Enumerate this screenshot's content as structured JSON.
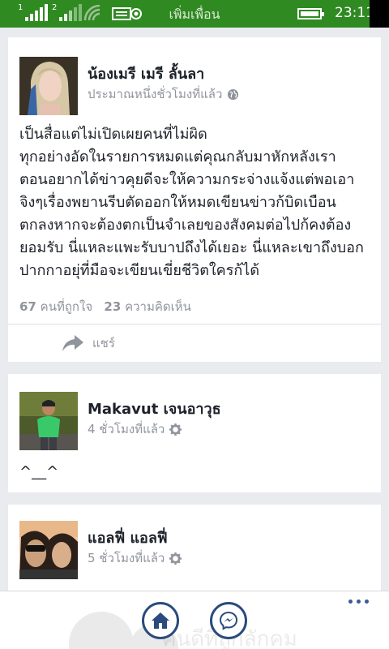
{
  "status_bar": {
    "title": "เพิ่มเพื่อน",
    "time": "23:11",
    "sim1": "1",
    "sim2": "2",
    "icons": [
      "signal-icon",
      "wifi-icon",
      "message-icon",
      "battery-icon"
    ],
    "background": "#2f8a22"
  },
  "posts": [
    {
      "author": "น้องเมรี เมรี ลั้นลา",
      "time": "ประมาณหนึ่งชั่วโมงที่แล้ว",
      "privacy_icon": "globe-icon",
      "lines": [
        "เป็นสื่อแต่ไม่เปิดเผยคนที่ไม่ผิด",
        "ทุกอย่างอัดในรายการหมดแต่คุณกลับมาหักหลังเรา",
        "ตอนอยากได้ข่าวคุยดีจะให้ความกระจ่างแจ้งแต่พอเอา",
        "จิงๆเรื่องพยานรีบตัดออกให้หมดเขียนข่าวก้บิดเบือน",
        "ตกลงหากจะต้องตกเป็นจำเลยของสังคมต่อไปก้คงต้อง",
        "ยอมรับ นี่แหละแพะรับบาปถึงได้เยอะ นี่แหละเขาถึงบอก",
        "ปากกาอยุ่ที่มือจะเขียนเขี่ยชีวิตใครก้ได้"
      ],
      "likes": "67",
      "likes_label": "คนที่ถูกใจ",
      "comments": "23",
      "comments_label": "ความคิดเห็น",
      "share_label": "แชร์"
    },
    {
      "author": "Makavut เจนอาวุธ",
      "time": "4 ชั่วโมงที่แล้ว",
      "privacy_icon": "gear-icon",
      "text": "^__^"
    },
    {
      "author": "แอลฟี่ แอลฟี่",
      "time": "5 ชั่วโมงที่แล้ว",
      "privacy_icon": "gear-icon"
    }
  ],
  "bottom_bar": {
    "home_icon": "home-icon",
    "messenger_icon": "messenger-icon",
    "more_icon": "more-icon",
    "watermark_text": "คนดีที่ถูกลักคม",
    "accent": "#2a4b7c"
  }
}
